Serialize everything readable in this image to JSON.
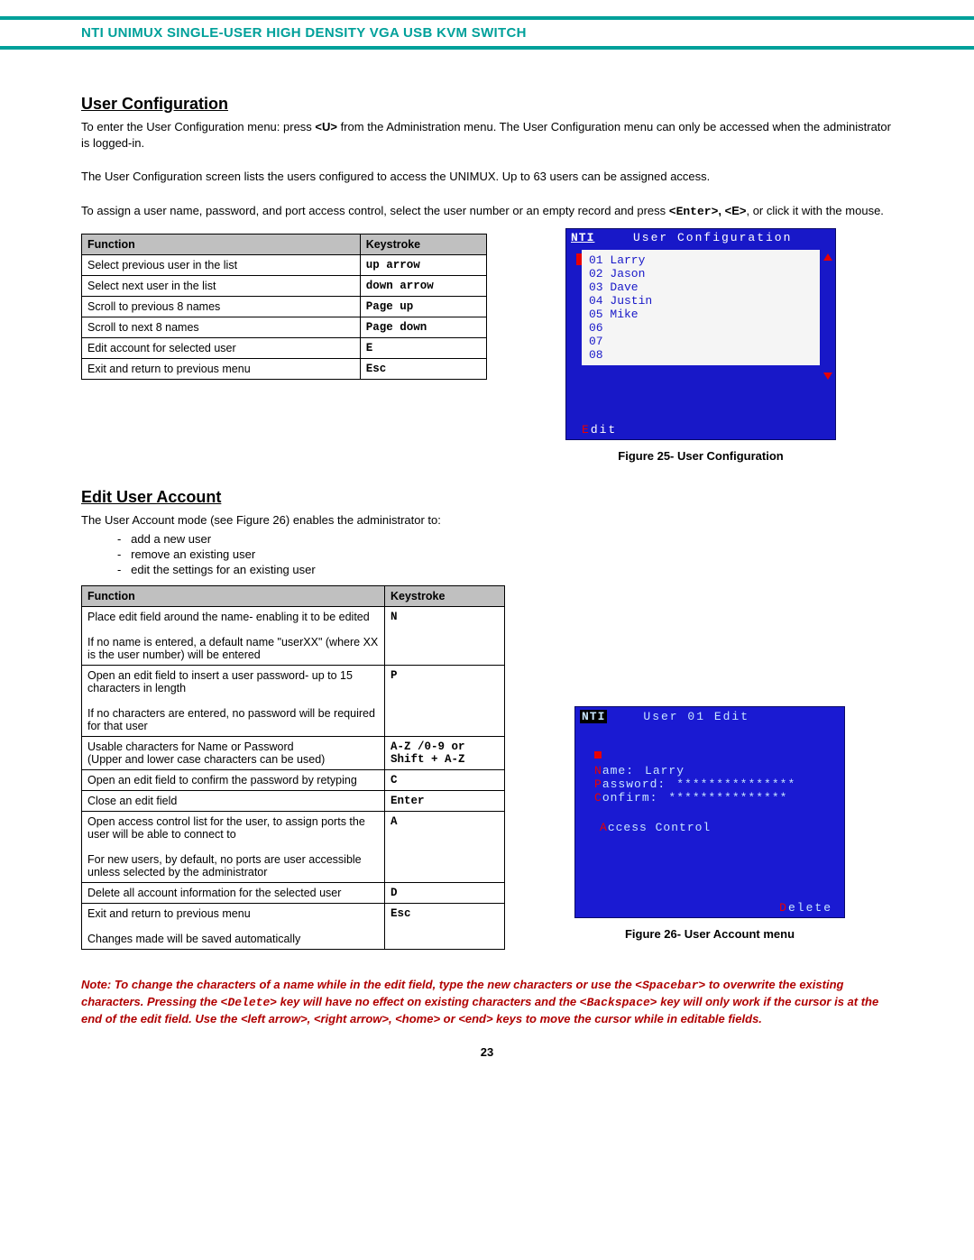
{
  "header": {
    "title": "NTI UNIMUX SINGLE-USER HIGH DENSITY VGA USB KVM SWITCH"
  },
  "section1": {
    "heading": "User Configuration",
    "p1a": "To enter the User Configuration menu: press ",
    "p1key": "<U>",
    "p1b": " from the Administration menu.    The User Configuration menu can only be accessed when the administrator is logged-in.",
    "p2": "The User Configuration screen lists the users configured to access the UNIMUX.    Up to 63 users can be assigned access.",
    "p3a": "To assign a user name, password, and port access control, select the user number or an empty record and press ",
    "p3k1": "<Enter>",
    "p3k2": ", <E>",
    "p3b": ", or click it with the mouse."
  },
  "table1": {
    "headers": {
      "func": "Function",
      "key": "Keystroke"
    },
    "rows": [
      {
        "func": "Select previous user in the list",
        "key": "up arrow"
      },
      {
        "func": "Select next user in the list",
        "key": "down arrow"
      },
      {
        "func": "Scroll to previous 8 names",
        "key": "Page up"
      },
      {
        "func": "Scroll to next 8 names",
        "key": "Page down"
      },
      {
        "func": "Edit account for selected user",
        "key": "E"
      },
      {
        "func": "Exit and return to previous menu",
        "key": "Esc"
      }
    ]
  },
  "fig25": {
    "nti": "NTI",
    "title": "User Configuration",
    "users": [
      "01 Larry",
      "02 Jason",
      "03 Dave",
      "04 Justin",
      "05 Mike",
      "06",
      "07",
      "08"
    ],
    "edit_hot": "E",
    "edit_rest": "dit",
    "caption": "Figure 25- User Configuration"
  },
  "section2": {
    "heading": "Edit User Account",
    "intro": "The User Account mode (see Figure 26) enables the administrator to:",
    "bullets": [
      "add a new user",
      "remove an existing user",
      "edit the settings for an existing user"
    ]
  },
  "table2": {
    "headers": {
      "func": "Function",
      "key": "Keystroke"
    },
    "rows": [
      {
        "func": "Place edit field around the name- enabling it to be edited\n\nIf no name is entered, a default name \"userXX\" (where XX is the user number) will be entered",
        "key": "N"
      },
      {
        "func": "Open an edit field to insert a user password- up to 15 characters in length\n\nIf no characters are entered, no password will be required for that user",
        "key": "P"
      },
      {
        "func": "Usable characters for Name or Password\n(Upper and lower case characters can be used)",
        "key": "A-Z /0-9 or\nShift + A-Z"
      },
      {
        "func": "Open an edit field to confirm the password by retyping",
        "key": "C"
      },
      {
        "func": "Close an edit field",
        "key": "Enter"
      },
      {
        "func": "Open access control list for the user, to assign ports the user will  be able to connect to\n\nFor new users, by default, no ports are user accessible unless selected by the administrator",
        "key": "A"
      },
      {
        "func": "Delete all account information for the selected user",
        "key": "D"
      },
      {
        "func": "Exit and return to previous menu\n\nChanges made will be saved automatically",
        "key": "Esc"
      }
    ]
  },
  "fig26": {
    "nti": "NTI",
    "title": "User 01 Edit",
    "name_lbl_hot": "N",
    "name_lbl_rest": "ame:",
    "name_val": "Larry",
    "pass_lbl_hot": "P",
    "pass_lbl_rest": "assword:",
    "pass_val": "***************",
    "conf_lbl_hot": "C",
    "conf_lbl_rest": "onfirm:",
    "conf_val": "***************",
    "ac_hot": "A",
    "ac_rest": "ccess Control",
    "del_hot": "D",
    "del_rest": "elete",
    "caption": "Figure 26- User Account menu"
  },
  "note": {
    "t1": "Note: To change the characters of a name while in the edit field, type the new characters or use the ",
    "k1": "<Spacebar>",
    "t2": " to overwrite the existing characters.    Pressing the ",
    "k2": "<Delete>",
    "t3": "  key will have no effect on existing characters and the ",
    "k3": "<Backspace>",
    "t4": " key will only work if the cursor is at the end of the edit field. Use the <left arrow>, <right arrow>, <home> or <end>  keys to move the cursor while in editable fields."
  },
  "page_number": "23"
}
